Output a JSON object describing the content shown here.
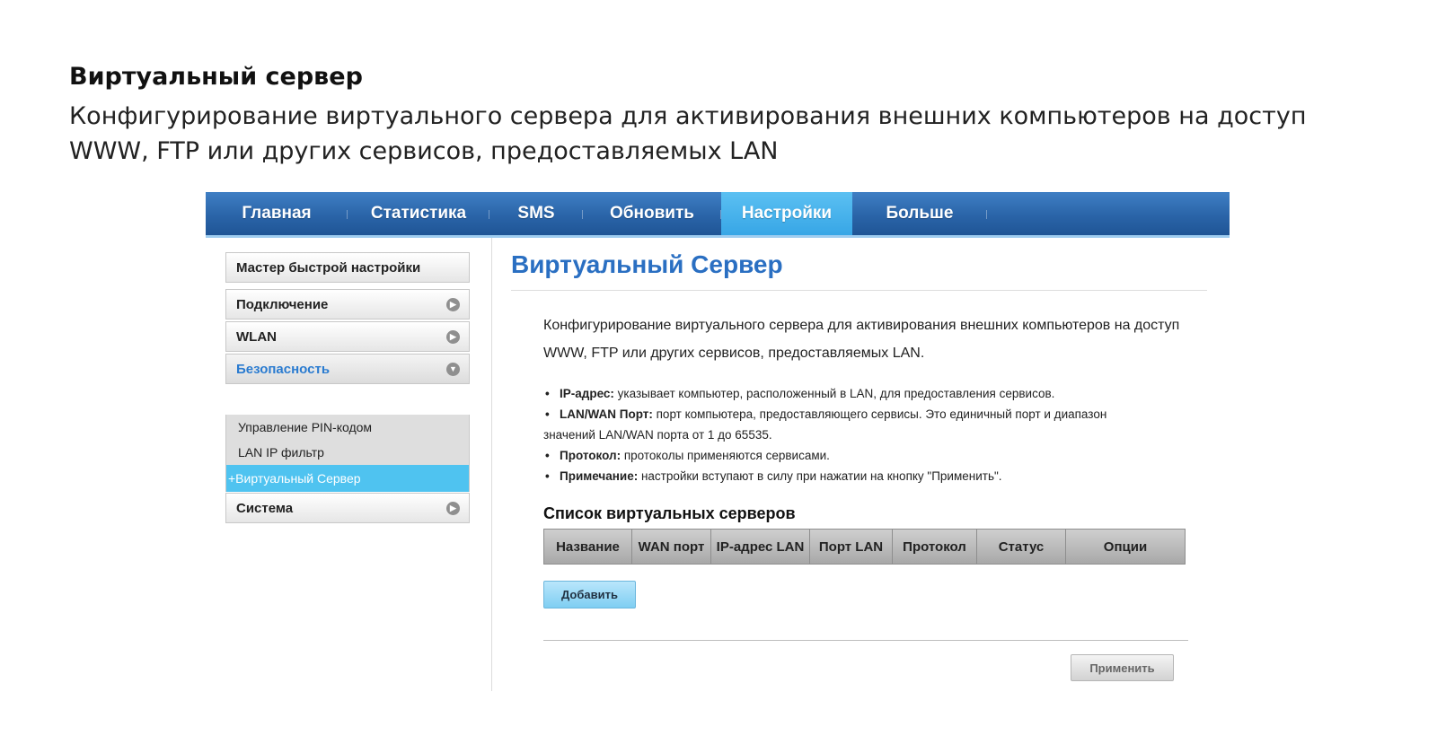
{
  "doc": {
    "heading": "Виртуальный сервер",
    "description": "Конфигурирование виртуального сервера для активирования внешних компьютеров на доступ WWW, FTP или других сервисов, предоставляемых LAN"
  },
  "nav": {
    "tabs": [
      {
        "label": "Главная"
      },
      {
        "label": "Статистика"
      },
      {
        "label": "SMS"
      },
      {
        "label": "Обновить"
      },
      {
        "label": "Настройки",
        "active": true
      },
      {
        "label": "Больше"
      }
    ]
  },
  "sidebar": {
    "items": [
      {
        "label": "Мастер быстрой настройки"
      },
      {
        "label": "Подключение",
        "icon": "chevron-right-icon"
      },
      {
        "label": "WLAN",
        "icon": "chevron-right-icon"
      },
      {
        "label": "Безопасность",
        "icon": "chevron-down-icon",
        "expanded": true
      },
      {
        "label": "Система",
        "icon": "chevron-right-icon"
      }
    ],
    "security_sub": [
      {
        "label": "Управление PIN-кодом"
      },
      {
        "label": "LAN IP фильтр"
      },
      {
        "label": "+Виртуальный Сервер",
        "active": true
      }
    ]
  },
  "main": {
    "title": "Виртуальный Сервер",
    "intro": "Конфигурирование виртуального сервера для активирования внешних компьютеров на доступ WWW, FTP или других сервисов, предоставляемых LAN.",
    "bullets": [
      {
        "term": "IP-адрес:",
        "text": " указывает компьютер, расположенный в LAN, для предоставления сервисов."
      },
      {
        "term": "LAN/WAN Порт:",
        "text": " порт компьютера, предоставляющего сервисы. Это единичный порт и диапазон"
      },
      {
        "cont": "значений LAN/WAN порта от 1 до 65535."
      },
      {
        "term": "Протокол:",
        "text": " протоколы применяются сервисами."
      },
      {
        "term": "Примечание:",
        "text": " настройки вступают в силу при нажатии на кнопку \"Применить\"."
      }
    ],
    "list_heading": "Список виртуальных серверов",
    "table_headers": [
      "Название",
      "WAN порт",
      "IP-адрес LAN",
      "Порт LAN",
      "Протокол",
      "Статус",
      "Опции"
    ],
    "add_label": "Добавить",
    "apply_label": "Применить"
  },
  "colors": {
    "nav_bar": "#2a64a8",
    "nav_active": "#4fb6ee",
    "title_blue": "#2a6fc2",
    "sub_active": "#4fc3f0"
  }
}
